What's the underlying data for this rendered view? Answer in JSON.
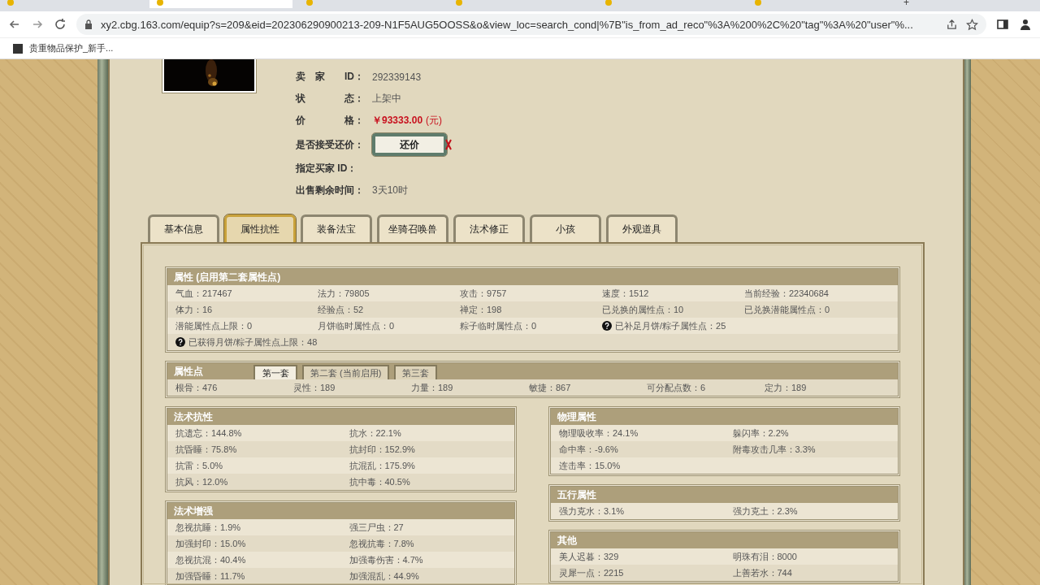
{
  "browser": {
    "tabs": [
      {
        "selected": false
      },
      {
        "selected": true
      },
      {
        "selected": false
      },
      {
        "selected": false
      },
      {
        "selected": false
      },
      {
        "selected": false
      }
    ],
    "new_tab": "+",
    "url": "xy2.cbg.163.com/equip?s=209&eid=202306290900213-209-N1F5AUG5OOSS&o&view_loc=search_cond|%7B\"is_from_ad_reco\"%3A%200%2C%20\"tag\"%3A%20\"user\"%...",
    "bookmarks": [
      "贵重物品保护_新手..."
    ]
  },
  "listing": {
    "fields": [
      {
        "kind": "text",
        "label": "卖　家　　ID：",
        "value": "292339143"
      },
      {
        "kind": "text",
        "label": "状　　　　态：",
        "value": "上架中"
      },
      {
        "kind": "price",
        "label": "价　　　　格：",
        "value": "￥93333.00",
        "unit": "(元)"
      },
      {
        "kind": "button",
        "label": "是否接受还价：",
        "value": "还价"
      },
      {
        "kind": "text",
        "label": "指定买家 ID："
      },
      {
        "kind": "text",
        "label": "出售剩余时间：",
        "value": "3天10时"
      }
    ]
  },
  "tabs": [
    {
      "label": "基本信息",
      "selected": false
    },
    {
      "label": "属性抗性",
      "selected": true
    },
    {
      "label": "装备法宝",
      "selected": false
    },
    {
      "label": "坐骑召唤兽",
      "selected": false
    },
    {
      "label": "法术修正",
      "selected": false
    },
    {
      "label": "小孩",
      "selected": false
    },
    {
      "label": "外观道具",
      "selected": false
    }
  ],
  "attributes": {
    "title": "属性 (启用第二套属性点)",
    "rows": [
      [
        {
          "text": "气血：217467",
          "help": false
        },
        {
          "text": "法力：79805",
          "help": false
        },
        {
          "text": "攻击：9757",
          "help": false
        },
        {
          "text": "速度：1512",
          "help": false
        },
        {
          "text": "当前经验：22340684",
          "help": false
        }
      ],
      [
        {
          "text": "体力：16",
          "help": false
        },
        {
          "text": "经验点：52",
          "help": false
        },
        {
          "text": "禅定：198",
          "help": false
        },
        {
          "text": "已兑换的属性点：10",
          "help": false
        },
        {
          "text": "已兑换潜能属性点：0",
          "help": false
        }
      ],
      [
        {
          "text": "潜能属性点上限：0",
          "help": false
        },
        {
          "text": "月饼临时属性点：0",
          "help": false
        },
        {
          "text": "粽子临时属性点：0",
          "help": false
        },
        {
          "text": "已补足月饼/粽子属性点：25",
          "help": true
        }
      ],
      [
        {
          "text": "已获得月饼/粽子属性点上限：48",
          "help": true
        }
      ]
    ]
  },
  "points": {
    "title": "属性点",
    "sets": [
      {
        "label": "第一套",
        "selected": true
      },
      {
        "label": "第二套 (当前启用)",
        "selected": false
      },
      {
        "label": "第三套",
        "selected": false
      }
    ],
    "values": [
      "根骨：476",
      "灵性：189",
      "力量：189",
      "敏捷：867",
      "可分配点数：6",
      "定力：189"
    ]
  },
  "left_sections": [
    {
      "title": "法术抗性",
      "rows": [
        [
          "抗遗忘：144.8%",
          "抗水：22.1%"
        ],
        [
          "抗昏睡：75.8%",
          "抗封印：152.9%"
        ],
        [
          "抗雷：5.0%",
          "抗混乱：175.9%"
        ],
        [
          "抗风：12.0%",
          "抗中毒：40.5%"
        ]
      ]
    },
    {
      "title": "法术增强",
      "rows": [
        [
          "忽视抗睡：1.9%",
          "强三尸虫：27"
        ],
        [
          "加强封印：15.0%",
          "忽视抗毒：7.8%"
        ],
        [
          "忽视抗混：40.4%",
          "加强毒伤害：4.7%"
        ],
        [
          "加强昏睡：11.7%",
          "加强混乱：44.9%"
        ]
      ]
    }
  ],
  "right_sections": [
    {
      "title": "物理属性",
      "rows": [
        [
          "物理吸收率：24.1%",
          "躲闪率：2.2%"
        ],
        [
          "命中率：-9.6%",
          "附毒攻击几率：3.3%"
        ],
        [
          "连击率：15.0%"
        ]
      ]
    },
    {
      "title": "五行属性",
      "rows": [
        [
          "强力克水：3.1%",
          "强力克土：2.3%"
        ]
      ]
    },
    {
      "title": "其他",
      "rows": [
        [
          "美人迟暮：329",
          "明珠有泪：8000"
        ],
        [
          "灵犀一点：2215",
          "上善若水：744"
        ]
      ]
    }
  ]
}
